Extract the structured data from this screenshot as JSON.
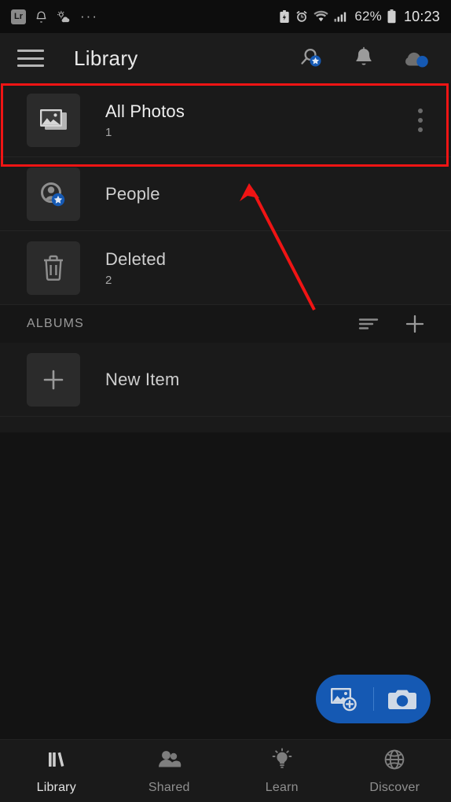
{
  "statusbar": {
    "app_icon_label": "Lr",
    "left_icons": [
      "lr-app-icon",
      "bell-icon",
      "weather-icon",
      "overflow-dots-icon"
    ],
    "overflow": "···",
    "right_icons": [
      "battery-saver-icon",
      "alarm-icon",
      "wifi-icon",
      "signal-icon",
      "battery-icon"
    ],
    "battery_percent": "62%",
    "time": "10:23"
  },
  "appbar": {
    "menu_icon": "hamburger-menu-icon",
    "title": "Library",
    "actions": [
      {
        "name": "search-premium-icon",
        "badge": "star"
      },
      {
        "name": "notifications-bell-icon",
        "badge": "none"
      },
      {
        "name": "cloud-sync-icon",
        "badge": "dot"
      }
    ]
  },
  "library": {
    "rows": [
      {
        "id": "all-photos",
        "icon": "photo-stack-icon",
        "title": "All Photos",
        "count": "1",
        "has_more": true,
        "highlighted": true
      },
      {
        "id": "people",
        "icon": "person-premium-icon",
        "title": "People",
        "count": "",
        "has_more": false,
        "highlighted": false
      },
      {
        "id": "deleted",
        "icon": "trash-icon",
        "title": "Deleted",
        "count": "2",
        "has_more": false,
        "highlighted": false
      }
    ],
    "albums": {
      "header": "ALBUMS",
      "sort_icon": "sort-lines-icon",
      "add_icon": "plus-icon",
      "items": [
        {
          "id": "new-item",
          "icon": "plus-icon",
          "title": "New Item",
          "count": ""
        }
      ]
    }
  },
  "fab": {
    "add_photo_icon": "add-photo-icon",
    "camera_icon": "camera-icon",
    "color": "#1559b3"
  },
  "bottomnav": {
    "items": [
      {
        "id": "library",
        "icon": "books-icon",
        "label": "Library",
        "active": true
      },
      {
        "id": "shared",
        "icon": "people-icon",
        "label": "Shared",
        "active": false
      },
      {
        "id": "learn",
        "icon": "lightbulb-icon",
        "label": "Learn",
        "active": false
      },
      {
        "id": "discover",
        "icon": "globe-icon",
        "label": "Discover",
        "active": false
      }
    ]
  },
  "annotation": {
    "highlight_color": "#f01414",
    "arrow_color": "#f01414",
    "target": "All Photos"
  }
}
